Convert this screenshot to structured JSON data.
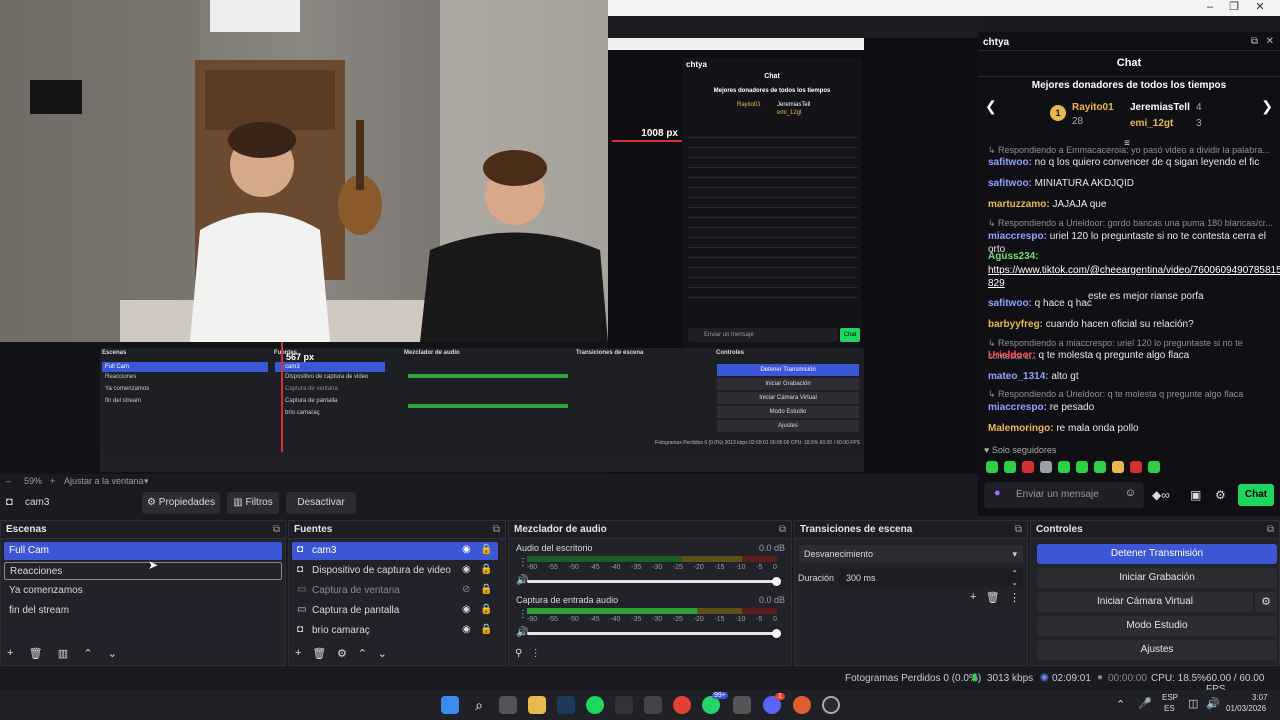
{
  "window": {
    "controls": [
      "–",
      "❐",
      "✕"
    ]
  },
  "nested": {
    "width_label": "1008 px",
    "height_label": "567 px",
    "chat_title": "chtya",
    "chat_header": "Chat",
    "donors_title": "Mejores donadores de todos los tiempos",
    "donor1": "Rayito01",
    "donor2": "JeremiasTell",
    "donor3": "emi_12gt",
    "docks": {
      "scenes": "Escenas",
      "sources": "Fuentes",
      "mixer": "Mezclador de audio",
      "transitions": "Transiciones de escena",
      "controls": "Controles"
    },
    "scene_items": [
      "Full Cam",
      "Reacciones",
      "Ya comenzamos",
      "fin del stream"
    ],
    "source_items": [
      "cam3",
      "Dispositivo de captura de video",
      "Captura de ventana",
      "Captura de pantalla",
      "brio camaraç"
    ],
    "control_items": [
      "Detener Transmisión",
      "Iniciar Grabación",
      "Iniciar Cámara Virtual",
      "Modo Estudio",
      "Ajustes"
    ],
    "status": "Fotogramas Perdidos 0 (0.0%)  3013 kbps  02:09:01  00:00:00  CPU: 18.5%  60.00 / 60.00 FPS",
    "send_placeholder": "Enviar un mensaje",
    "chat_button": "Chat"
  },
  "chat": {
    "channel": "chtya",
    "header": "Chat",
    "donors_title": "Mejores donadores de todos los tiempos",
    "donors": [
      {
        "name": "Rayito01",
        "count": "28"
      },
      {
        "name": "JeremiasTell",
        "count": "4"
      },
      {
        "name": "emi_12gt",
        "count": "3"
      }
    ],
    "messages": [
      {
        "reply": "↳ Respondiendo a Emmacaceroia: yo pasó video a dividir la palabra...",
        "user": "",
        "text": ""
      },
      {
        "reply": "",
        "user": "safitwoo:",
        "text": " no q los quiero convencer de q sigan leyendo el fic"
      },
      {
        "reply": "",
        "user": "safitwoo:",
        "text": " MINIATURA AKDJQID"
      },
      {
        "reply": "",
        "user": "martuzzamo:",
        "text": " JAJAJA que"
      },
      {
        "reply": "↳ Respondiendo a Urieldoor: gordo bancas una puma 180 blancas/cr...",
        "user": "miaccrespo:",
        "text": " uriel 120 lo preguntaste si no te contesta cerra el orto"
      },
      {
        "reply": "",
        "user": "Aguss234:",
        "text": ""
      },
      {
        "reply": "",
        "user": "",
        "text": "https://www.tiktok.com/@cheeargentina/video/7600609490785815 829"
      },
      {
        "reply": "",
        "user": "",
        "text": " este es mejor rianse porfa"
      },
      {
        "reply": "",
        "user": "safitwoo:",
        "text": " q hace q hac"
      },
      {
        "reply": "",
        "user": "barbyyfreg:",
        "text": " cuando hacen oficial su relación?"
      },
      {
        "reply": "↳ Respondiendo a miaccrespo: uriel 120 lo preguntaste si no te contesta c...",
        "user": "Urieldoor:",
        "text": " q te molesta q pregunte algo flaca"
      },
      {
        "reply": "",
        "user": "mateo_1314:",
        "text": " alto gt"
      },
      {
        "reply": "↳ Respondiendo a Urieldoor: q te molesta q pregunte algo flaca",
        "user": "miaccrespo:",
        "text": " re pesado"
      },
      {
        "reply": "",
        "user": "Malemoringo:",
        "text": " re mala onda pollo"
      }
    ],
    "followers_only": "Solo seguidores",
    "send_placeholder": "Enviar un mensaje",
    "chat_button": "Chat"
  },
  "zoom": {
    "minus": "–",
    "value": "59%",
    "plus": "+",
    "fit": "Ajustar a la ventana"
  },
  "source_toolbar": {
    "source_name": "cam3",
    "properties": "Propiedades",
    "filters": "Filtros",
    "deactivate": "Desactivar"
  },
  "scenes": {
    "title": "Escenas",
    "items": [
      "Full Cam",
      "Reacciones",
      "Ya comenzamos",
      "fin del stream"
    ]
  },
  "sources": {
    "title": "Fuentes",
    "items": [
      "cam3",
      "Dispositivo de captura de video",
      "Captura de ventana",
      "Captura de pantalla",
      "brio camaraç"
    ]
  },
  "mixer": {
    "title": "Mezclador de audio",
    "channels": [
      {
        "name": "Audio del escritorio",
        "db": "0.0 dB",
        "level": 0.0
      },
      {
        "name": "Captura de entrada audio",
        "db": "0.0 dB",
        "level": 0.68
      }
    ],
    "ticks": [
      "-60",
      "-55",
      "-50",
      "-45",
      "-40",
      "-35",
      "-30",
      "-25",
      "-20",
      "-15",
      "-10",
      "-5",
      "0"
    ]
  },
  "transitions": {
    "title": "Transiciones de escena",
    "selected": "Desvanecimiento",
    "duration_label": "Duración",
    "duration_value": "300 ms"
  },
  "controls": {
    "title": "Controles",
    "stop_stream": "Detener Transmisión",
    "start_recording": "Iniciar Grabación",
    "start_virtualcam": "Iniciar Cámara Virtual",
    "studio_mode": "Modo Estudio",
    "settings": "Ajustes"
  },
  "status": {
    "dropped": "Fotogramas Perdidos 0 (0.0%)",
    "bitrate": "3013 kbps",
    "stream_time": "02:09:01",
    "rec_time": "00:00:00",
    "cpu": "CPU: 18.5%",
    "fps": "60.00 / 60.00 FPS"
  },
  "taskbar": {
    "lang1": "ESP",
    "lang2": "ES",
    "time": "3:07",
    "date": "01/03/2026",
    "whatsapp_badge": "99+",
    "discord_badge": "1"
  },
  "colors": {
    "accent": "#3b57d6",
    "chat_button": "#1ed760",
    "live": "#ff3b3b"
  }
}
